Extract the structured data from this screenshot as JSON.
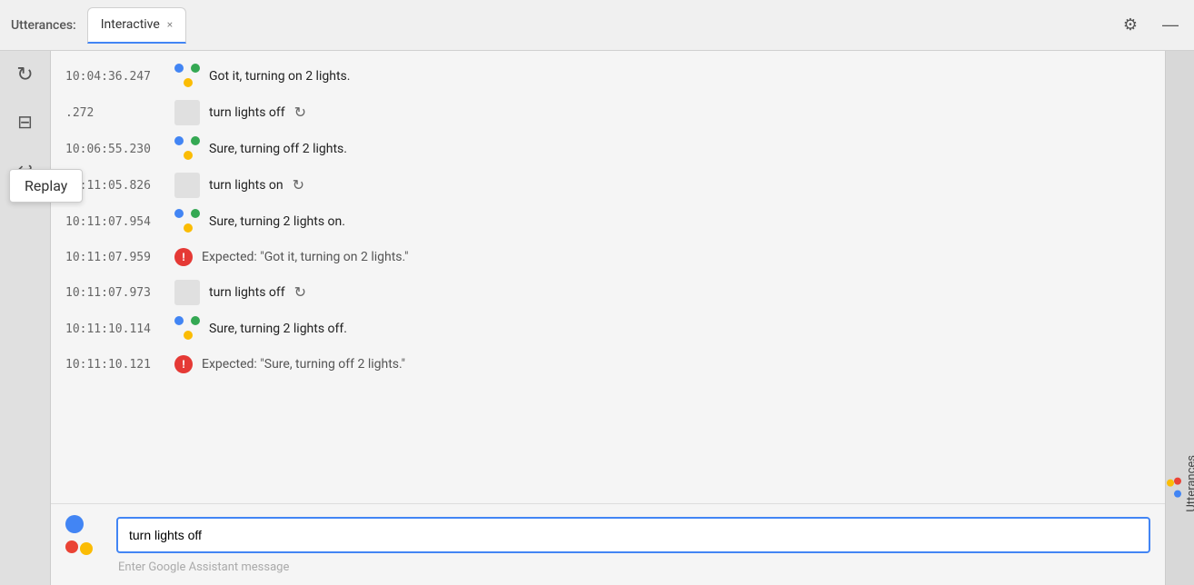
{
  "titleBar": {
    "label": "Utterances:",
    "tab": {
      "label": "Interactive",
      "closeLabel": "×"
    },
    "gearLabel": "⚙",
    "minimizeLabel": "—"
  },
  "leftSidebar": {
    "replayIconLabel": "↻",
    "saveIconLabel": "⊟",
    "undoIconLabel": "↩",
    "tooltip": "Replay"
  },
  "messages": [
    {
      "id": 1,
      "timestamp": "10:04:36.247",
      "type": "assistant",
      "text": "Got it, turning on 2 lights."
    },
    {
      "id": 2,
      "timestamp": ".272",
      "type": "user",
      "text": "turn lights off",
      "hasReplay": true
    },
    {
      "id": 3,
      "timestamp": "10:06:55.230",
      "type": "assistant",
      "text": "Sure, turning off 2 lights."
    },
    {
      "id": 4,
      "timestamp": "10:11:05.826",
      "type": "user",
      "text": "turn lights on",
      "hasReplay": true
    },
    {
      "id": 5,
      "timestamp": "10:11:07.954",
      "type": "assistant",
      "text": "Sure, turning 2 lights on."
    },
    {
      "id": 6,
      "timestamp": "10:11:07.959",
      "type": "error",
      "text": "Expected: \"Got it, turning on 2 lights.\""
    },
    {
      "id": 7,
      "timestamp": "10:11:07.973",
      "type": "user",
      "text": "turn lights off",
      "hasReplay": true
    },
    {
      "id": 8,
      "timestamp": "10:11:10.114",
      "type": "assistant",
      "text": "Sure, turning 2 lights off."
    },
    {
      "id": 9,
      "timestamp": "10:11:10.121",
      "type": "error",
      "text": "Expected: \"Sure, turning off 2 lights.\""
    }
  ],
  "inputArea": {
    "value": "turn lights off",
    "placeholder": "Enter Google Assistant message",
    "hintText": "Enter Google Assistant message"
  },
  "rightSidebar": {
    "label": "Utterances"
  }
}
